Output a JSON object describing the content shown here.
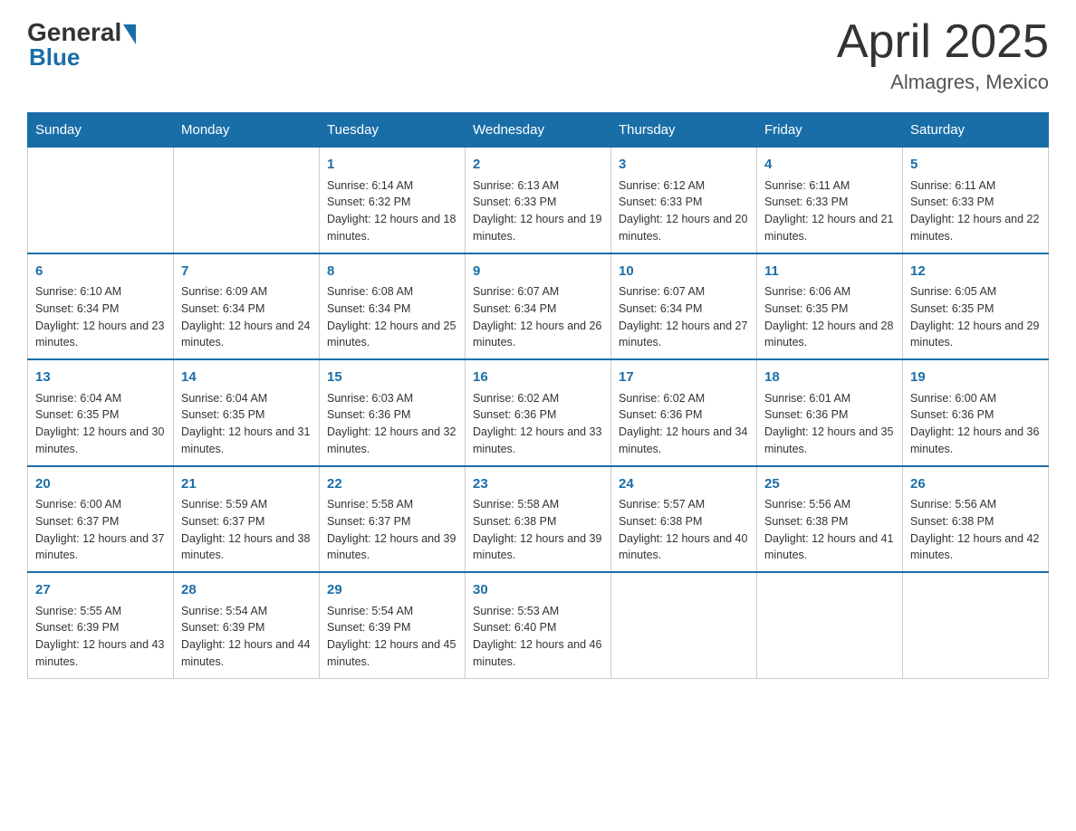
{
  "header": {
    "logo_general": "General",
    "logo_blue": "Blue",
    "title": "April 2025",
    "subtitle": "Almagres, Mexico"
  },
  "calendar": {
    "weekdays": [
      "Sunday",
      "Monday",
      "Tuesday",
      "Wednesday",
      "Thursday",
      "Friday",
      "Saturday"
    ],
    "weeks": [
      [
        {
          "day": "",
          "info": ""
        },
        {
          "day": "",
          "info": ""
        },
        {
          "day": "1",
          "info": "Sunrise: 6:14 AM\nSunset: 6:32 PM\nDaylight: 12 hours and 18 minutes."
        },
        {
          "day": "2",
          "info": "Sunrise: 6:13 AM\nSunset: 6:33 PM\nDaylight: 12 hours and 19 minutes."
        },
        {
          "day": "3",
          "info": "Sunrise: 6:12 AM\nSunset: 6:33 PM\nDaylight: 12 hours and 20 minutes."
        },
        {
          "day": "4",
          "info": "Sunrise: 6:11 AM\nSunset: 6:33 PM\nDaylight: 12 hours and 21 minutes."
        },
        {
          "day": "5",
          "info": "Sunrise: 6:11 AM\nSunset: 6:33 PM\nDaylight: 12 hours and 22 minutes."
        }
      ],
      [
        {
          "day": "6",
          "info": "Sunrise: 6:10 AM\nSunset: 6:34 PM\nDaylight: 12 hours and 23 minutes."
        },
        {
          "day": "7",
          "info": "Sunrise: 6:09 AM\nSunset: 6:34 PM\nDaylight: 12 hours and 24 minutes."
        },
        {
          "day": "8",
          "info": "Sunrise: 6:08 AM\nSunset: 6:34 PM\nDaylight: 12 hours and 25 minutes."
        },
        {
          "day": "9",
          "info": "Sunrise: 6:07 AM\nSunset: 6:34 PM\nDaylight: 12 hours and 26 minutes."
        },
        {
          "day": "10",
          "info": "Sunrise: 6:07 AM\nSunset: 6:34 PM\nDaylight: 12 hours and 27 minutes."
        },
        {
          "day": "11",
          "info": "Sunrise: 6:06 AM\nSunset: 6:35 PM\nDaylight: 12 hours and 28 minutes."
        },
        {
          "day": "12",
          "info": "Sunrise: 6:05 AM\nSunset: 6:35 PM\nDaylight: 12 hours and 29 minutes."
        }
      ],
      [
        {
          "day": "13",
          "info": "Sunrise: 6:04 AM\nSunset: 6:35 PM\nDaylight: 12 hours and 30 minutes."
        },
        {
          "day": "14",
          "info": "Sunrise: 6:04 AM\nSunset: 6:35 PM\nDaylight: 12 hours and 31 minutes."
        },
        {
          "day": "15",
          "info": "Sunrise: 6:03 AM\nSunset: 6:36 PM\nDaylight: 12 hours and 32 minutes."
        },
        {
          "day": "16",
          "info": "Sunrise: 6:02 AM\nSunset: 6:36 PM\nDaylight: 12 hours and 33 minutes."
        },
        {
          "day": "17",
          "info": "Sunrise: 6:02 AM\nSunset: 6:36 PM\nDaylight: 12 hours and 34 minutes."
        },
        {
          "day": "18",
          "info": "Sunrise: 6:01 AM\nSunset: 6:36 PM\nDaylight: 12 hours and 35 minutes."
        },
        {
          "day": "19",
          "info": "Sunrise: 6:00 AM\nSunset: 6:36 PM\nDaylight: 12 hours and 36 minutes."
        }
      ],
      [
        {
          "day": "20",
          "info": "Sunrise: 6:00 AM\nSunset: 6:37 PM\nDaylight: 12 hours and 37 minutes."
        },
        {
          "day": "21",
          "info": "Sunrise: 5:59 AM\nSunset: 6:37 PM\nDaylight: 12 hours and 38 minutes."
        },
        {
          "day": "22",
          "info": "Sunrise: 5:58 AM\nSunset: 6:37 PM\nDaylight: 12 hours and 39 minutes."
        },
        {
          "day": "23",
          "info": "Sunrise: 5:58 AM\nSunset: 6:38 PM\nDaylight: 12 hours and 39 minutes."
        },
        {
          "day": "24",
          "info": "Sunrise: 5:57 AM\nSunset: 6:38 PM\nDaylight: 12 hours and 40 minutes."
        },
        {
          "day": "25",
          "info": "Sunrise: 5:56 AM\nSunset: 6:38 PM\nDaylight: 12 hours and 41 minutes."
        },
        {
          "day": "26",
          "info": "Sunrise: 5:56 AM\nSunset: 6:38 PM\nDaylight: 12 hours and 42 minutes."
        }
      ],
      [
        {
          "day": "27",
          "info": "Sunrise: 5:55 AM\nSunset: 6:39 PM\nDaylight: 12 hours and 43 minutes."
        },
        {
          "day": "28",
          "info": "Sunrise: 5:54 AM\nSunset: 6:39 PM\nDaylight: 12 hours and 44 minutes."
        },
        {
          "day": "29",
          "info": "Sunrise: 5:54 AM\nSunset: 6:39 PM\nDaylight: 12 hours and 45 minutes."
        },
        {
          "day": "30",
          "info": "Sunrise: 5:53 AM\nSunset: 6:40 PM\nDaylight: 12 hours and 46 minutes."
        },
        {
          "day": "",
          "info": ""
        },
        {
          "day": "",
          "info": ""
        },
        {
          "day": "",
          "info": ""
        }
      ]
    ]
  }
}
